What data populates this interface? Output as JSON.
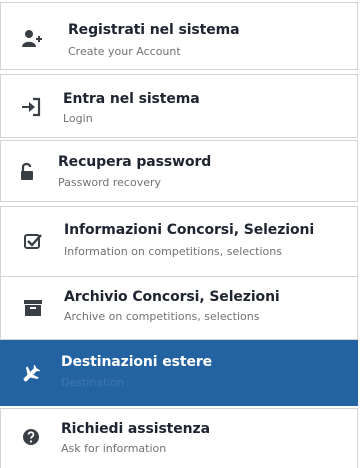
{
  "colors": {
    "active_background": "#2463a2",
    "border": "#d4d4d4",
    "title_text": "#1f2530",
    "subtitle_text": "#6f7276"
  },
  "menu": {
    "items": [
      {
        "title": "Registrati nel sistema",
        "subtitle": "Create your Account",
        "icon": "add-user-icon",
        "active": false
      },
      {
        "title": "Entra nel sistema",
        "subtitle": "Login",
        "icon": "sign-in-icon",
        "active": false
      },
      {
        "title": "Recupera password",
        "subtitle": "Password recovery",
        "icon": "unlock-icon",
        "active": false
      },
      {
        "title": "Informazioni Concorsi, Selezioni",
        "subtitle": "Information on competitions, selections",
        "icon": "checkbox-icon",
        "active": false
      },
      {
        "title": "Archivio Concorsi, Selezioni",
        "subtitle": "Archive on competitions, selections",
        "icon": "archive-icon",
        "active": false
      },
      {
        "title": "Destinazioni estere",
        "subtitle": "Destination",
        "icon": "plane-icon",
        "active": true
      },
      {
        "title": "Richiedi assistenza",
        "subtitle": "Ask for information",
        "icon": "help-circle-icon",
        "active": false
      }
    ]
  }
}
